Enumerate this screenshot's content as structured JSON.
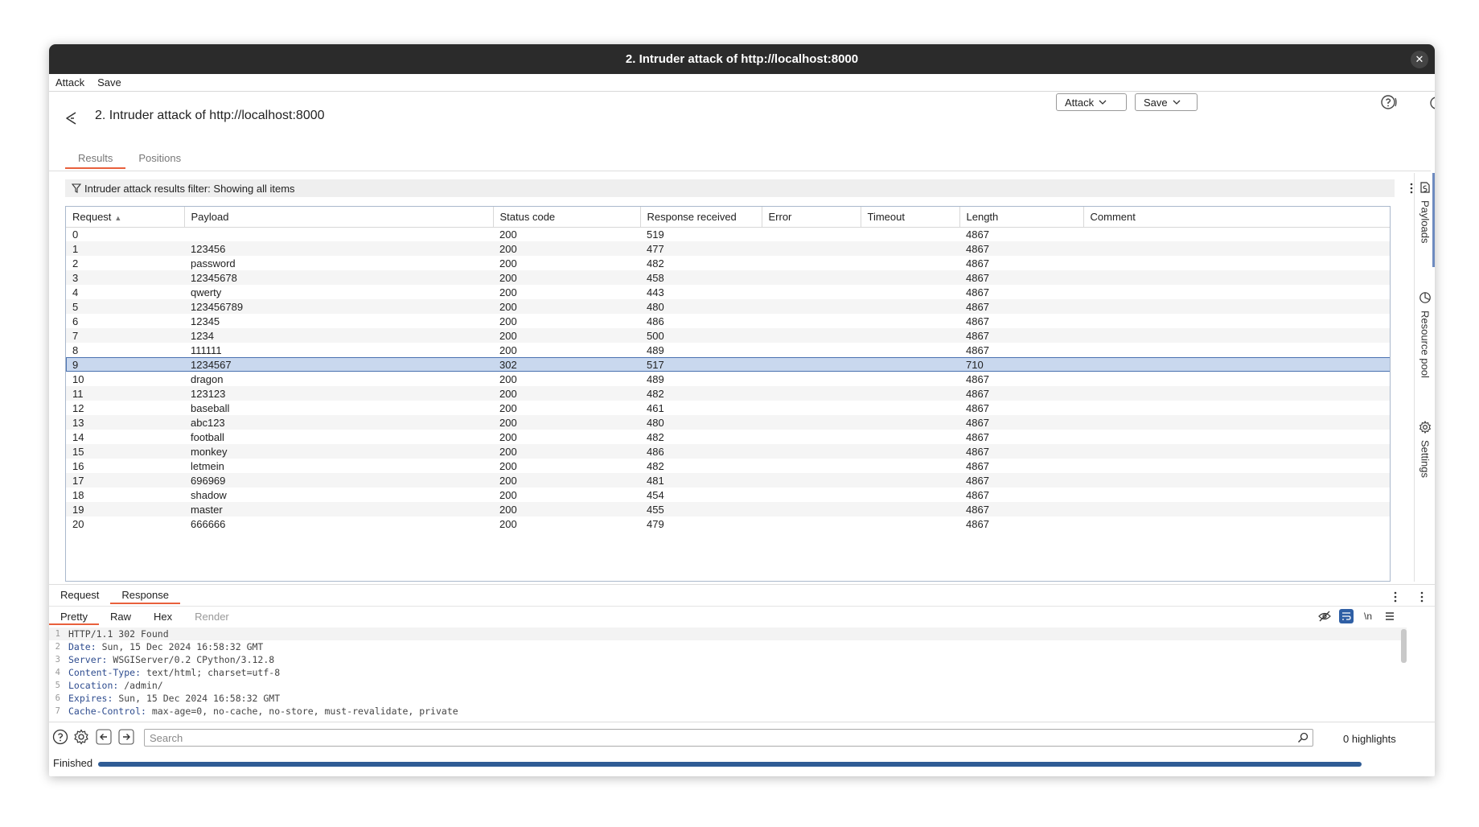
{
  "window": {
    "title": "2. Intruder attack of http://localhost:8000",
    "close_glyph": "✕"
  },
  "menu": [
    "Attack",
    "Save"
  ],
  "header": {
    "title": "2. Intruder attack of http://localhost:8000",
    "attack_button": "Attack",
    "save_button": "Save"
  },
  "tabs": [
    {
      "label": "Results",
      "active": true
    },
    {
      "label": "Positions",
      "active": false
    }
  ],
  "filter": {
    "text": "Intruder attack results filter: Showing all items"
  },
  "table": {
    "columns": [
      "Request",
      "Payload",
      "Status code",
      "Response received",
      "Error",
      "Timeout",
      "Length",
      "Comment"
    ],
    "sort_column": "Request",
    "selected_row": 9,
    "rows": [
      [
        "0",
        "",
        "200",
        "519",
        "",
        "",
        "4867",
        ""
      ],
      [
        "1",
        "123456",
        "200",
        "477",
        "",
        "",
        "4867",
        ""
      ],
      [
        "2",
        "password",
        "200",
        "482",
        "",
        "",
        "4867",
        ""
      ],
      [
        "3",
        "12345678",
        "200",
        "458",
        "",
        "",
        "4867",
        ""
      ],
      [
        "4",
        "qwerty",
        "200",
        "443",
        "",
        "",
        "4867",
        ""
      ],
      [
        "5",
        "123456789",
        "200",
        "480",
        "",
        "",
        "4867",
        ""
      ],
      [
        "6",
        "12345",
        "200",
        "486",
        "",
        "",
        "4867",
        ""
      ],
      [
        "7",
        "1234",
        "200",
        "500",
        "",
        "",
        "4867",
        ""
      ],
      [
        "8",
        "111111",
        "200",
        "489",
        "",
        "",
        "4867",
        ""
      ],
      [
        "9",
        "1234567",
        "302",
        "517",
        "",
        "",
        "710",
        ""
      ],
      [
        "10",
        "dragon",
        "200",
        "489",
        "",
        "",
        "4867",
        ""
      ],
      [
        "11",
        "123123",
        "200",
        "482",
        "",
        "",
        "4867",
        ""
      ],
      [
        "12",
        "baseball",
        "200",
        "461",
        "",
        "",
        "4867",
        ""
      ],
      [
        "13",
        "abc123",
        "200",
        "480",
        "",
        "",
        "4867",
        ""
      ],
      [
        "14",
        "football",
        "200",
        "482",
        "",
        "",
        "4867",
        ""
      ],
      [
        "15",
        "monkey",
        "200",
        "486",
        "",
        "",
        "4867",
        ""
      ],
      [
        "16",
        "letmein",
        "200",
        "482",
        "",
        "",
        "4867",
        ""
      ],
      [
        "17",
        "696969",
        "200",
        "481",
        "",
        "",
        "4867",
        ""
      ],
      [
        "18",
        "shadow",
        "200",
        "454",
        "",
        "",
        "4867",
        ""
      ],
      [
        "19",
        "master",
        "200",
        "455",
        "",
        "",
        "4867",
        ""
      ],
      [
        "20",
        "666666",
        "200",
        "479",
        "",
        "",
        "4867",
        ""
      ]
    ]
  },
  "side_panel": {
    "items": [
      "Payloads",
      "Resource pool",
      "Settings"
    ]
  },
  "message": {
    "tabs": [
      {
        "label": "Request",
        "active": false
      },
      {
        "label": "Response",
        "active": true
      }
    ],
    "views": [
      {
        "label": "Pretty",
        "active": true,
        "disabled": false
      },
      {
        "label": "Raw",
        "active": false,
        "disabled": false
      },
      {
        "label": "Hex",
        "active": false,
        "disabled": false
      },
      {
        "label": "Render",
        "active": false,
        "disabled": true
      }
    ],
    "newline_label": "\\n",
    "lines": [
      {
        "n": "1",
        "key": "",
        "value": "HTTP/1.1 302 Found"
      },
      {
        "n": "2",
        "key": "Date",
        "value": " Sun, 15 Dec 2024 16:58:32 GMT"
      },
      {
        "n": "3",
        "key": "Server",
        "value": " WSGIServer/0.2 CPython/3.12.8"
      },
      {
        "n": "4",
        "key": "Content-Type",
        "value": " text/html; charset=utf-8"
      },
      {
        "n": "5",
        "key": "Location",
        "value": " /admin/"
      },
      {
        "n": "6",
        "key": "Expires",
        "value": " Sun, 15 Dec 2024 16:58:32 GMT"
      },
      {
        "n": "7",
        "key": "Cache-Control",
        "value": " max-age=0, no-cache, no-store, must-revalidate, private"
      }
    ]
  },
  "search": {
    "placeholder": "Search",
    "highlights": "0 highlights"
  },
  "status": {
    "text": "Finished",
    "progress": 1.0
  },
  "colors": {
    "accent_tab": "#e8603c",
    "selected_row": "#c9d8ee",
    "progress": "#2f5c95",
    "header_key": "#2e4c8f"
  }
}
